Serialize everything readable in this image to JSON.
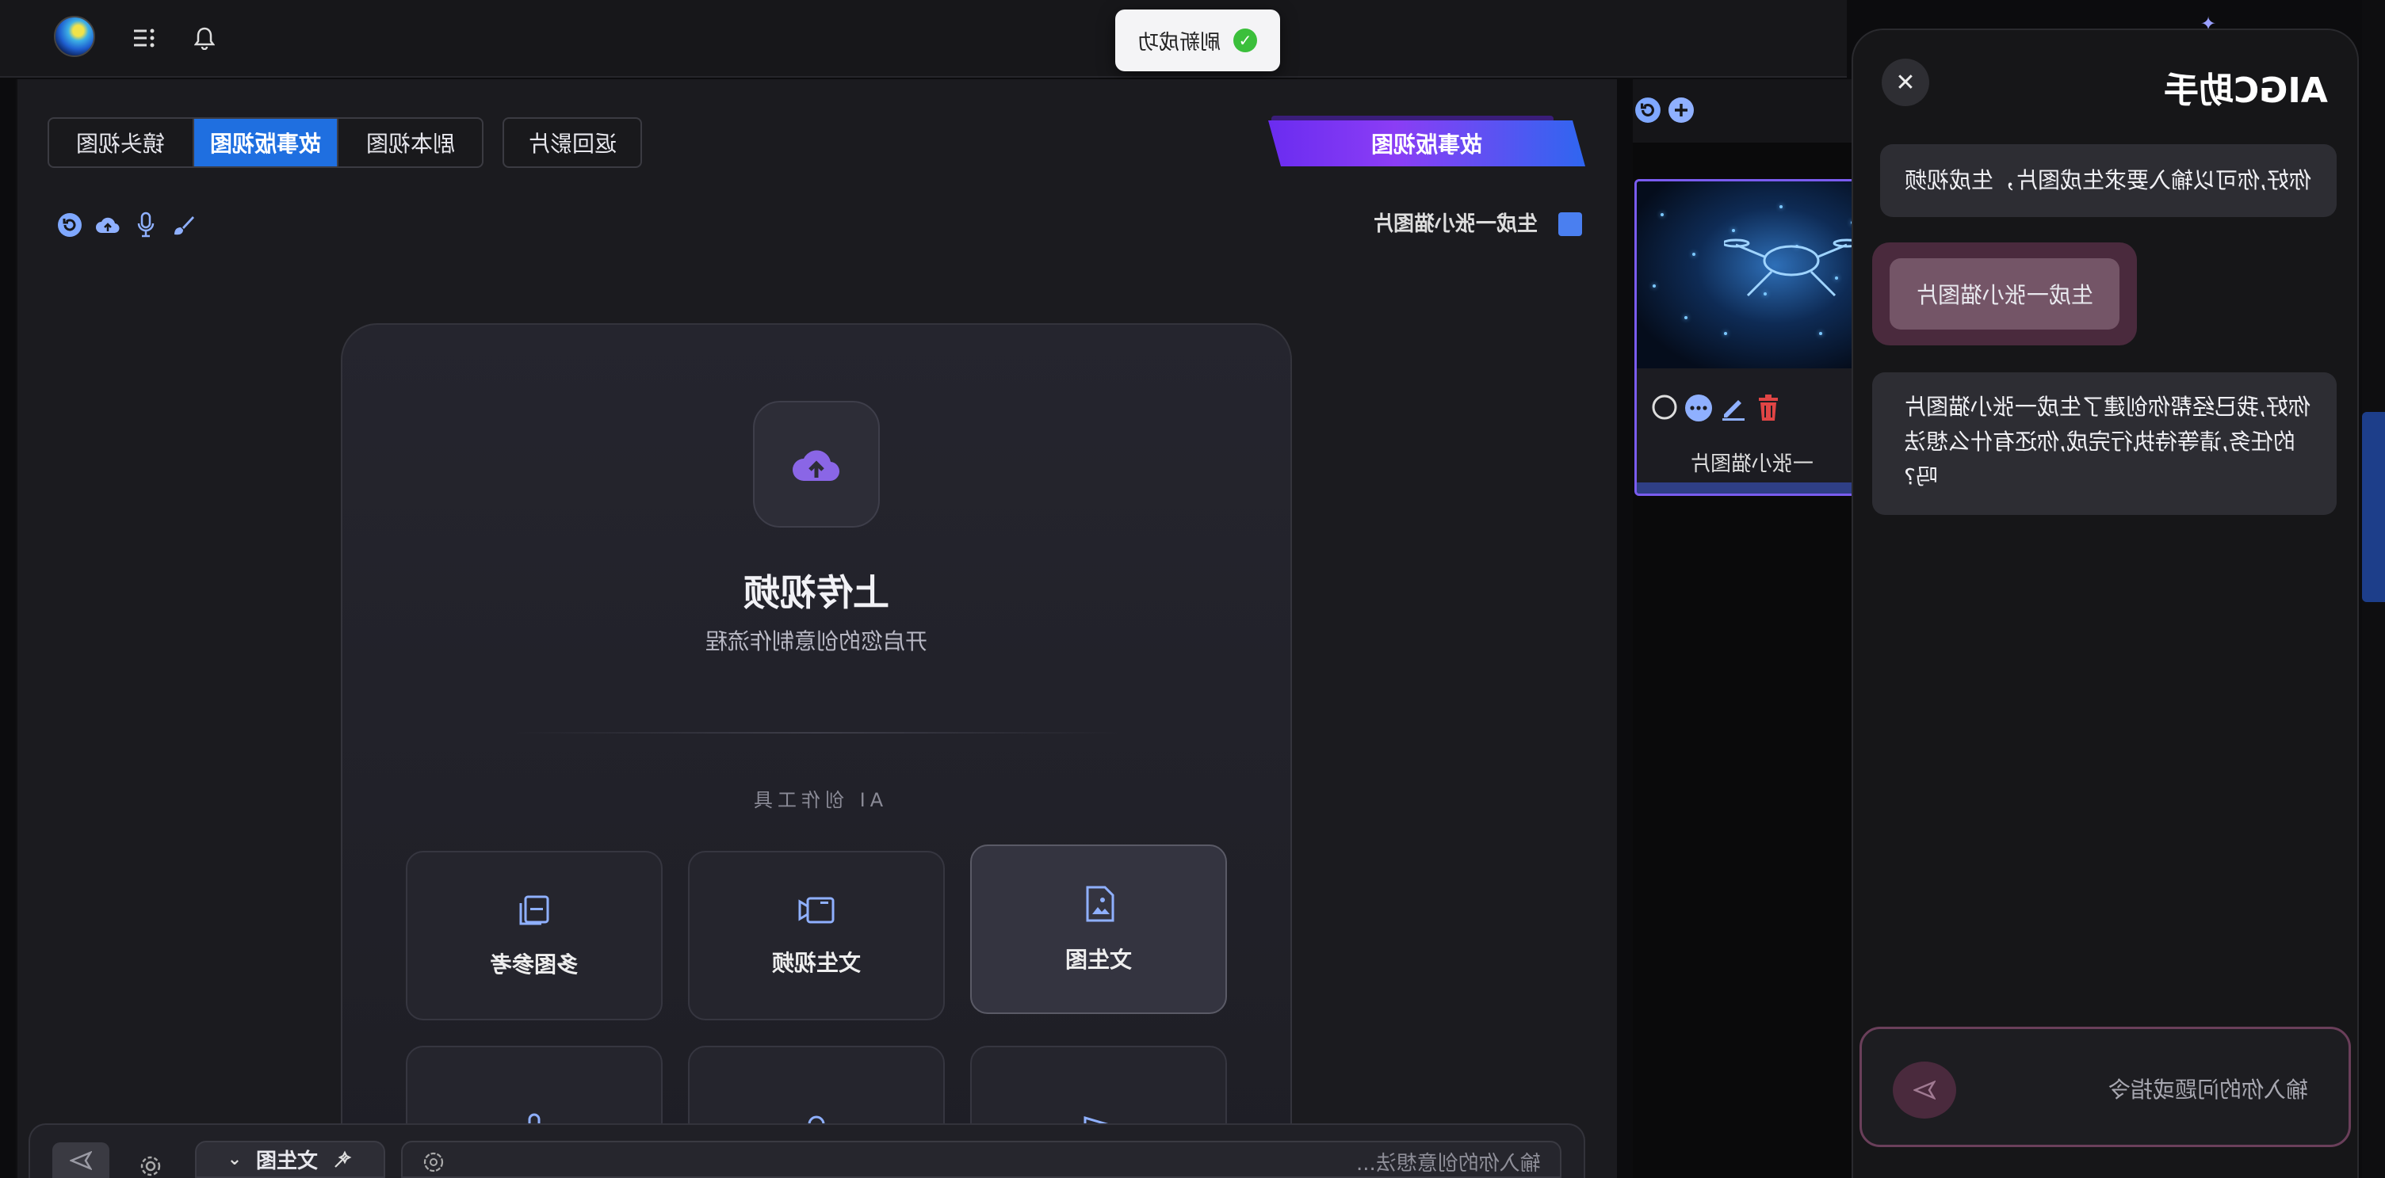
{
  "toast": {
    "message": "刷新成功"
  },
  "tabs": [
    {
      "label": "镜头视图"
    },
    {
      "label": "故事版视图"
    },
    {
      "label": "剧本视图"
    }
  ],
  "back_button": "返回影片",
  "storyboard_badge": "故事版视图",
  "prompt_label": "生成一张小猫图片",
  "upload": {
    "title": "上传视频",
    "subtitle": "开启您的创意制作流程",
    "tools_heading": "AI 创作工具"
  },
  "tools": [
    {
      "label": "多图参考",
      "icon": "copy-icon"
    },
    {
      "label": "文生视频",
      "icon": "video-icon"
    },
    {
      "label": "文生图",
      "icon": "image-icon"
    }
  ],
  "bottom_bar": {
    "mode": "文生图",
    "placeholder": "输入你的创意想法..."
  },
  "thumbnail": {
    "caption": "一张小猫图片"
  },
  "assistant": {
    "title": "AIGC助手",
    "messages": [
      {
        "role": "bot",
        "text": "你好,你可以输入要求生成图片，生成视频"
      },
      {
        "role": "user",
        "text": "生成一张小猫图片"
      },
      {
        "role": "bot",
        "lines": [
          "你好,我已经帮你创建了生成一张小猫图片",
          "的任务,请等待执行完成,你还有什么想法",
          "吗?"
        ]
      }
    ],
    "input_placeholder": "输入你的问题或指令"
  },
  "colors": {
    "accent_blue": "#1f6fe0",
    "accent_purple": "#7a5cf0",
    "user_bubble": "#745567"
  }
}
